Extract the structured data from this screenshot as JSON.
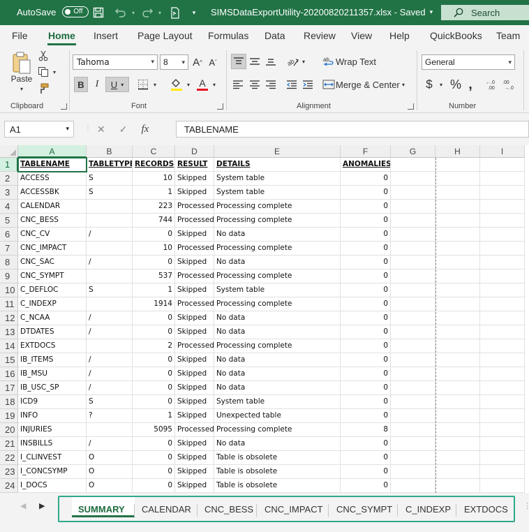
{
  "titlebar": {
    "autosave_label": "AutoSave",
    "autosave_state": "Off",
    "document_title": "SIMSDataExportUtility-20200820211357.xlsx - Saved",
    "search_label": "Search"
  },
  "menu": {
    "tabs": [
      "File",
      "Home",
      "Insert",
      "Page Layout",
      "Formulas",
      "Data",
      "Review",
      "View",
      "Help",
      "QuickBooks",
      "Team"
    ],
    "active": "Home"
  },
  "ribbon": {
    "clipboard": {
      "label": "Clipboard",
      "paste_label": "Paste"
    },
    "font": {
      "label": "Font",
      "font_name": "Tahoma",
      "font_size": "8"
    },
    "alignment": {
      "label": "Alignment",
      "wrap_text": "Wrap Text",
      "merge_center": "Merge & Center"
    },
    "number": {
      "label": "Number",
      "format": "General"
    }
  },
  "formula_bar": {
    "name_box": "A1",
    "formula": "TABLENAME"
  },
  "grid": {
    "columns": [
      "A",
      "B",
      "C",
      "D",
      "E",
      "F",
      "G",
      "H",
      "I"
    ],
    "header_row": [
      "TABLENAME",
      "TABLETYPE",
      "RECORDS",
      "RESULT",
      "DETAILS",
      "ANOMALIES"
    ],
    "rows": [
      [
        "ACCESS",
        "S",
        "10",
        "Skipped",
        "System table",
        "0"
      ],
      [
        "ACCESSBK",
        "S",
        "1",
        "Skipped",
        "System table",
        "0"
      ],
      [
        "CALENDAR",
        "",
        "223",
        "Processed",
        "Processing complete",
        "0"
      ],
      [
        "CNC_BESS",
        "",
        "744",
        "Processed",
        "Processing complete",
        "0"
      ],
      [
        "CNC_CV",
        "/",
        "0",
        "Skipped",
        "No data",
        "0"
      ],
      [
        "CNC_IMPACT",
        "",
        "10",
        "Processed",
        "Processing complete",
        "0"
      ],
      [
        "CNC_SAC",
        "/",
        "0",
        "Skipped",
        "No data",
        "0"
      ],
      [
        "CNC_SYMPT",
        "",
        "537",
        "Processed",
        "Processing complete",
        "0"
      ],
      [
        "C_DEFLOC",
        "S",
        "1",
        "Skipped",
        "System table",
        "0"
      ],
      [
        "C_INDEXP",
        "",
        "1914",
        "Processed",
        "Processing complete",
        "0"
      ],
      [
        "C_NCAA",
        "/",
        "0",
        "Skipped",
        "No data",
        "0"
      ],
      [
        "DTDATES",
        "/",
        "0",
        "Skipped",
        "No data",
        "0"
      ],
      [
        "EXTDOCS",
        "",
        "2",
        "Processed",
        "Processing complete",
        "0"
      ],
      [
        "IB_ITEMS",
        "/",
        "0",
        "Skipped",
        "No data",
        "0"
      ],
      [
        "IB_MSU",
        "/",
        "0",
        "Skipped",
        "No data",
        "0"
      ],
      [
        "IB_USC_SP",
        "/",
        "0",
        "Skipped",
        "No data",
        "0"
      ],
      [
        "ICD9",
        "S",
        "0",
        "Skipped",
        "System table",
        "0"
      ],
      [
        "INFO",
        "?",
        "1",
        "Skipped",
        "Unexpected table",
        "0"
      ],
      [
        "INJURIES",
        "",
        "5095",
        "Processed",
        "Processing complete",
        "8"
      ],
      [
        "INSBILLS",
        "/",
        "0",
        "Skipped",
        "No data",
        "0"
      ],
      [
        "I_CLINVEST",
        "O",
        "0",
        "Skipped",
        "Table is obsolete",
        "0"
      ],
      [
        "I_CONCSYMP",
        "O",
        "0",
        "Skipped",
        "Table is obsolete",
        "0"
      ],
      [
        "I_DOCS",
        "O",
        "0",
        "Skipped",
        "Table is obsolete",
        "0"
      ]
    ]
  },
  "sheets": {
    "tabs": [
      "SUMMARY",
      "CALENDAR",
      "CNC_BESS",
      "CNC_IMPACT",
      "CNC_SYMPT",
      "C_INDEXP",
      "EXTDOCS"
    ],
    "active": "SUMMARY"
  },
  "colors": {
    "accent": "#217346",
    "highlight_border": "#2ea98b"
  }
}
